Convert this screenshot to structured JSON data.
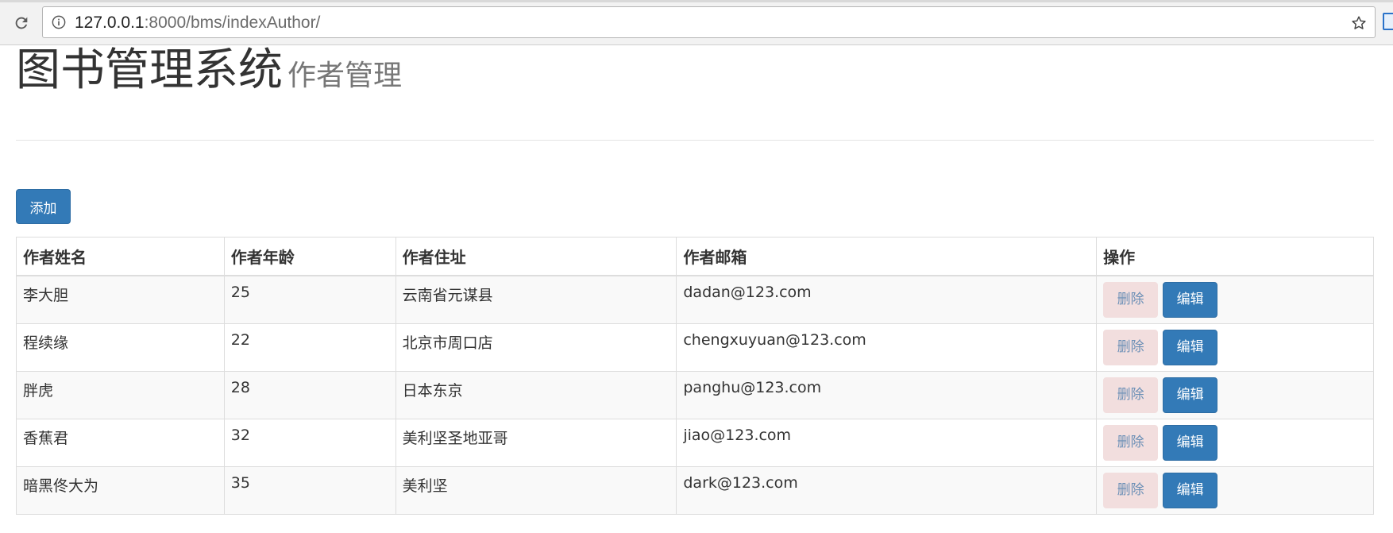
{
  "browser": {
    "url_host": "127.0.0.1",
    "url_path": ":8000/bms/indexAuthor/"
  },
  "header": {
    "title": "图书管理系统",
    "subtitle": "作者管理"
  },
  "toolbar": {
    "add_label": "添加"
  },
  "table": {
    "headers": [
      "作者姓名",
      "作者年龄",
      "作者住址",
      "作者邮箱",
      "操作"
    ],
    "rows": [
      {
        "name": "李大胆",
        "age": "25",
        "address": "云南省元谋县",
        "email": "dadan@123.com"
      },
      {
        "name": "程续缘",
        "age": "22",
        "address": "北京市周口店",
        "email": "chengxuyuan@123.com"
      },
      {
        "name": "胖虎",
        "age": "28",
        "address": "日本东京",
        "email": "panghu@123.com"
      },
      {
        "name": "香蕉君",
        "age": "32",
        "address": "美利坚圣地亚哥",
        "email": "jiao@123.com"
      },
      {
        "name": "暗黑佟大为",
        "age": "35",
        "address": "美利坚",
        "email": "dark@123.com"
      }
    ],
    "delete_label": "删除",
    "edit_label": "编辑"
  },
  "colors": {
    "primary": "#337ab7",
    "danger_bg": "#f2dede",
    "stripe": "#f9f9f9"
  },
  "icons": {
    "reload": "reload-icon",
    "info": "info-icon",
    "star": "star-icon"
  }
}
